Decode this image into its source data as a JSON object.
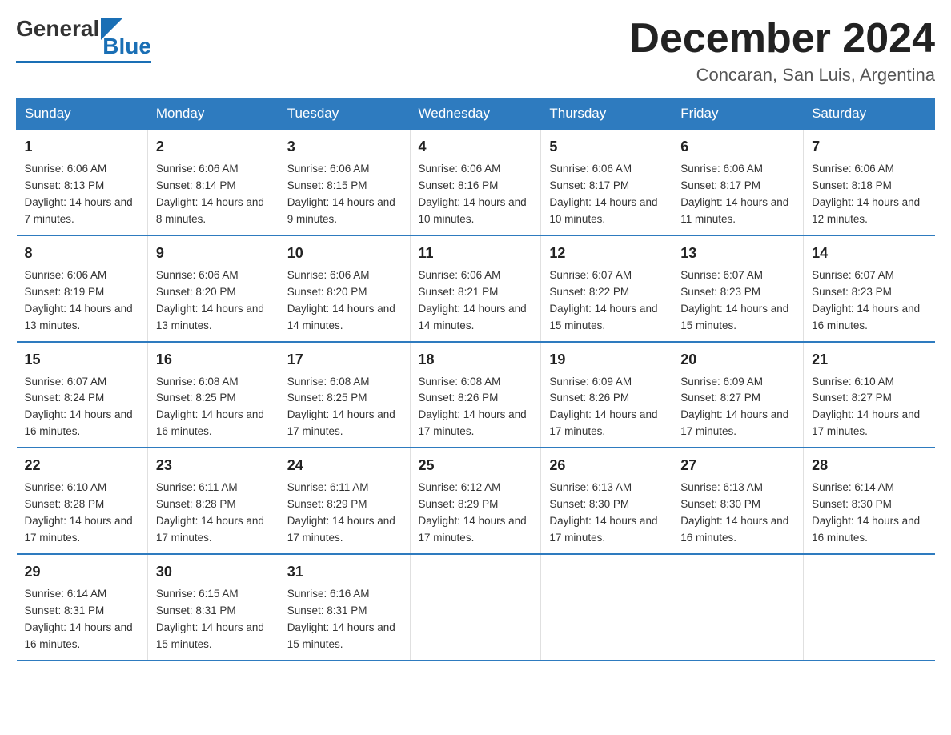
{
  "header": {
    "logo_general": "General",
    "logo_blue": "Blue",
    "month_title": "December 2024",
    "location": "Concaran, San Luis, Argentina"
  },
  "days_of_week": [
    "Sunday",
    "Monday",
    "Tuesday",
    "Wednesday",
    "Thursday",
    "Friday",
    "Saturday"
  ],
  "weeks": [
    [
      {
        "day": "1",
        "sunrise": "Sunrise: 6:06 AM",
        "sunset": "Sunset: 8:13 PM",
        "daylight": "Daylight: 14 hours and 7 minutes."
      },
      {
        "day": "2",
        "sunrise": "Sunrise: 6:06 AM",
        "sunset": "Sunset: 8:14 PM",
        "daylight": "Daylight: 14 hours and 8 minutes."
      },
      {
        "day": "3",
        "sunrise": "Sunrise: 6:06 AM",
        "sunset": "Sunset: 8:15 PM",
        "daylight": "Daylight: 14 hours and 9 minutes."
      },
      {
        "day": "4",
        "sunrise": "Sunrise: 6:06 AM",
        "sunset": "Sunset: 8:16 PM",
        "daylight": "Daylight: 14 hours and 10 minutes."
      },
      {
        "day": "5",
        "sunrise": "Sunrise: 6:06 AM",
        "sunset": "Sunset: 8:17 PM",
        "daylight": "Daylight: 14 hours and 10 minutes."
      },
      {
        "day": "6",
        "sunrise": "Sunrise: 6:06 AM",
        "sunset": "Sunset: 8:17 PM",
        "daylight": "Daylight: 14 hours and 11 minutes."
      },
      {
        "day": "7",
        "sunrise": "Sunrise: 6:06 AM",
        "sunset": "Sunset: 8:18 PM",
        "daylight": "Daylight: 14 hours and 12 minutes."
      }
    ],
    [
      {
        "day": "8",
        "sunrise": "Sunrise: 6:06 AM",
        "sunset": "Sunset: 8:19 PM",
        "daylight": "Daylight: 14 hours and 13 minutes."
      },
      {
        "day": "9",
        "sunrise": "Sunrise: 6:06 AM",
        "sunset": "Sunset: 8:20 PM",
        "daylight": "Daylight: 14 hours and 13 minutes."
      },
      {
        "day": "10",
        "sunrise": "Sunrise: 6:06 AM",
        "sunset": "Sunset: 8:20 PM",
        "daylight": "Daylight: 14 hours and 14 minutes."
      },
      {
        "day": "11",
        "sunrise": "Sunrise: 6:06 AM",
        "sunset": "Sunset: 8:21 PM",
        "daylight": "Daylight: 14 hours and 14 minutes."
      },
      {
        "day": "12",
        "sunrise": "Sunrise: 6:07 AM",
        "sunset": "Sunset: 8:22 PM",
        "daylight": "Daylight: 14 hours and 15 minutes."
      },
      {
        "day": "13",
        "sunrise": "Sunrise: 6:07 AM",
        "sunset": "Sunset: 8:23 PM",
        "daylight": "Daylight: 14 hours and 15 minutes."
      },
      {
        "day": "14",
        "sunrise": "Sunrise: 6:07 AM",
        "sunset": "Sunset: 8:23 PM",
        "daylight": "Daylight: 14 hours and 16 minutes."
      }
    ],
    [
      {
        "day": "15",
        "sunrise": "Sunrise: 6:07 AM",
        "sunset": "Sunset: 8:24 PM",
        "daylight": "Daylight: 14 hours and 16 minutes."
      },
      {
        "day": "16",
        "sunrise": "Sunrise: 6:08 AM",
        "sunset": "Sunset: 8:25 PM",
        "daylight": "Daylight: 14 hours and 16 minutes."
      },
      {
        "day": "17",
        "sunrise": "Sunrise: 6:08 AM",
        "sunset": "Sunset: 8:25 PM",
        "daylight": "Daylight: 14 hours and 17 minutes."
      },
      {
        "day": "18",
        "sunrise": "Sunrise: 6:08 AM",
        "sunset": "Sunset: 8:26 PM",
        "daylight": "Daylight: 14 hours and 17 minutes."
      },
      {
        "day": "19",
        "sunrise": "Sunrise: 6:09 AM",
        "sunset": "Sunset: 8:26 PM",
        "daylight": "Daylight: 14 hours and 17 minutes."
      },
      {
        "day": "20",
        "sunrise": "Sunrise: 6:09 AM",
        "sunset": "Sunset: 8:27 PM",
        "daylight": "Daylight: 14 hours and 17 minutes."
      },
      {
        "day": "21",
        "sunrise": "Sunrise: 6:10 AM",
        "sunset": "Sunset: 8:27 PM",
        "daylight": "Daylight: 14 hours and 17 minutes."
      }
    ],
    [
      {
        "day": "22",
        "sunrise": "Sunrise: 6:10 AM",
        "sunset": "Sunset: 8:28 PM",
        "daylight": "Daylight: 14 hours and 17 minutes."
      },
      {
        "day": "23",
        "sunrise": "Sunrise: 6:11 AM",
        "sunset": "Sunset: 8:28 PM",
        "daylight": "Daylight: 14 hours and 17 minutes."
      },
      {
        "day": "24",
        "sunrise": "Sunrise: 6:11 AM",
        "sunset": "Sunset: 8:29 PM",
        "daylight": "Daylight: 14 hours and 17 minutes."
      },
      {
        "day": "25",
        "sunrise": "Sunrise: 6:12 AM",
        "sunset": "Sunset: 8:29 PM",
        "daylight": "Daylight: 14 hours and 17 minutes."
      },
      {
        "day": "26",
        "sunrise": "Sunrise: 6:13 AM",
        "sunset": "Sunset: 8:30 PM",
        "daylight": "Daylight: 14 hours and 17 minutes."
      },
      {
        "day": "27",
        "sunrise": "Sunrise: 6:13 AM",
        "sunset": "Sunset: 8:30 PM",
        "daylight": "Daylight: 14 hours and 16 minutes."
      },
      {
        "day": "28",
        "sunrise": "Sunrise: 6:14 AM",
        "sunset": "Sunset: 8:30 PM",
        "daylight": "Daylight: 14 hours and 16 minutes."
      }
    ],
    [
      {
        "day": "29",
        "sunrise": "Sunrise: 6:14 AM",
        "sunset": "Sunset: 8:31 PM",
        "daylight": "Daylight: 14 hours and 16 minutes."
      },
      {
        "day": "30",
        "sunrise": "Sunrise: 6:15 AM",
        "sunset": "Sunset: 8:31 PM",
        "daylight": "Daylight: 14 hours and 15 minutes."
      },
      {
        "day": "31",
        "sunrise": "Sunrise: 6:16 AM",
        "sunset": "Sunset: 8:31 PM",
        "daylight": "Daylight: 14 hours and 15 minutes."
      },
      {
        "day": "",
        "sunrise": "",
        "sunset": "",
        "daylight": ""
      },
      {
        "day": "",
        "sunrise": "",
        "sunset": "",
        "daylight": ""
      },
      {
        "day": "",
        "sunrise": "",
        "sunset": "",
        "daylight": ""
      },
      {
        "day": "",
        "sunrise": "",
        "sunset": "",
        "daylight": ""
      }
    ]
  ]
}
